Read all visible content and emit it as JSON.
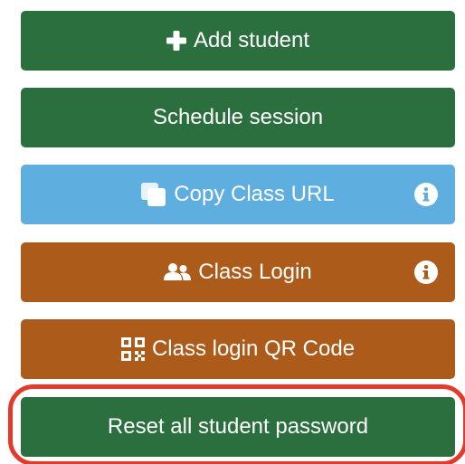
{
  "buttons": {
    "add_student": {
      "label": "Add student",
      "icon": "plus-icon",
      "color": "#2b6f3f"
    },
    "schedule_session": {
      "label": "Schedule session",
      "color": "#2b6f3f"
    },
    "copy_class_url": {
      "label": "Copy Class URL",
      "icon": "copy-icon",
      "info_icon": "info-icon",
      "color": "#5faee0"
    },
    "class_login": {
      "label": "Class Login",
      "icon": "users-icon",
      "info_icon": "info-icon",
      "color": "#ad5b1a"
    },
    "class_login_qr": {
      "label": "Class login QR Code",
      "icon": "qr-code-icon",
      "color": "#ad5b1a"
    },
    "reset_passwords": {
      "label": "Reset all student password",
      "color": "#2b6f3f",
      "highlight_color": "#e23b2c"
    }
  }
}
